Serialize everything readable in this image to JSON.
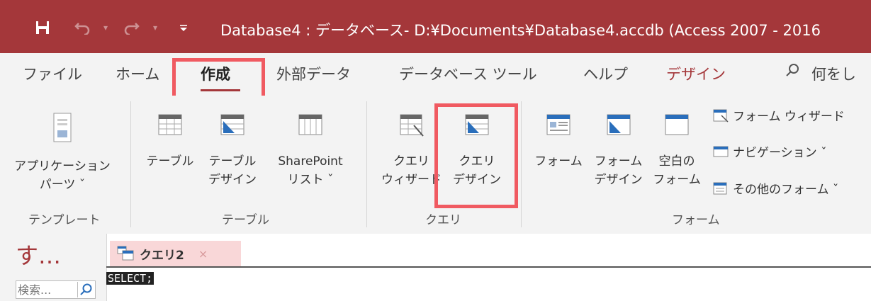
{
  "titlebar": {
    "title": "Database4 : データベース- D:¥Documents¥Database4.accdb (Access 2007 - 2016",
    "save_icon": "save-icon",
    "undo_icon": "undo-icon",
    "redo_icon": "redo-icon",
    "customize_icon": "customize-qat-icon"
  },
  "tabs": {
    "file": "ファイル",
    "home": "ホーム",
    "create": "作成",
    "external": "外部データ",
    "dbtools": "データベース ツール",
    "help": "ヘルプ",
    "design": "デザイン",
    "tellme": "何をし"
  },
  "ribbon": {
    "templates": {
      "app_parts_line1": "アプリケーション",
      "app_parts_line2": "パーツ ˇ",
      "label": "テンプレート"
    },
    "tables": {
      "table": "テーブル",
      "table_design_line1": "テーブル",
      "table_design_line2": "デザイン",
      "sharepoint_line1": "SharePoint",
      "sharepoint_line2": "リスト ˇ",
      "label": "テーブル"
    },
    "queries": {
      "wizard_line1": "クエリ",
      "wizard_line2": "ウィザード",
      "design_line1": "クエリ",
      "design_line2": "デザイン",
      "label": "クエリ"
    },
    "forms": {
      "form": "フォーム",
      "form_design_line1": "フォーム",
      "form_design_line2": "デザイン",
      "blank_line1": "空白の",
      "blank_line2": "フォーム",
      "form_wizard": "フォーム ウィザード",
      "navigation": "ナビゲーション ˇ",
      "more_forms": "その他のフォーム ˇ",
      "label": "フォーム"
    }
  },
  "nav": {
    "title": "す…",
    "search_placeholder": "検索..."
  },
  "document": {
    "tab_label": "クエリ2",
    "close": "×",
    "sql": "SELECT;"
  },
  "colors": {
    "accent": "#a4373a",
    "highlight": "#f05a61",
    "tab_bg": "#f9d7d8"
  }
}
